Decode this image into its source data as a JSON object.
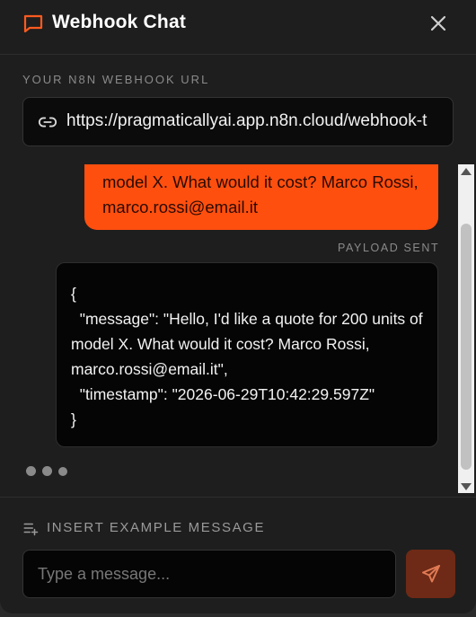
{
  "header": {
    "title": "Webhook Chat",
    "chat_icon": "message-square-icon",
    "close_icon": "close-icon"
  },
  "webhook": {
    "label": "YOUR N8N WEBHOOK URL",
    "url": "https://pragmaticallyai.app.n8n.cloud/webhook-t",
    "icon": "link-icon"
  },
  "messages": {
    "user_message": "model X. What would it cost? Marco Rossi, marco.rossi@email.it",
    "payload_label": "PAYLOAD SENT",
    "payload": "{\n  \"message\": \"Hello, I'd like a quote for 200 units of model X. What would it cost? Marco Rossi, marco.rossi@email.it\",\n  \"timestamp\": \"2026-06-29T10:42:29.597Z\"\n}"
  },
  "footer": {
    "insert_example_label": "INSERT EXAMPLE MESSAGE",
    "input_placeholder": "Type a message...",
    "input_value": "",
    "send_icon": "send-icon"
  },
  "colors": {
    "accent": "#ff4f0f",
    "send_button": "#6e2a16",
    "panel_bg": "#1e1e1e"
  }
}
